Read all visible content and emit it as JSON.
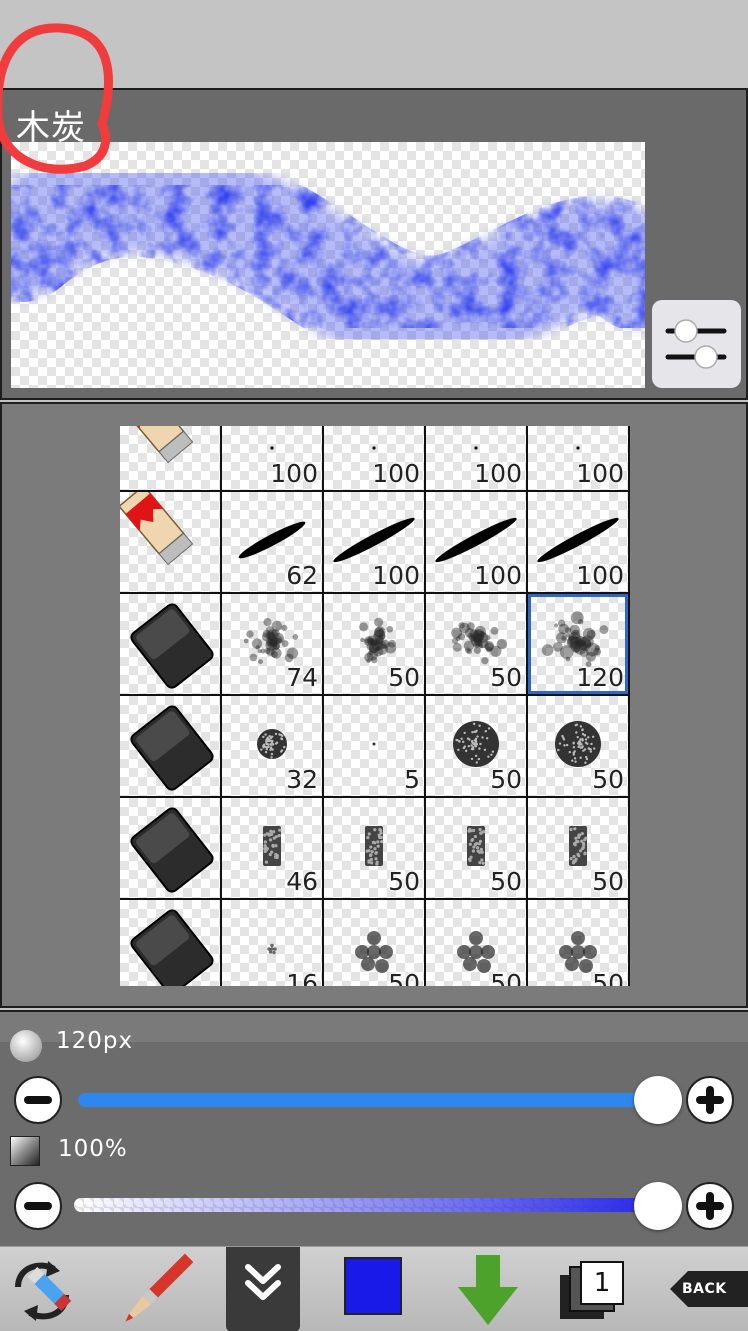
{
  "brush_preview": {
    "name": "木炭",
    "stroke_color": "#2d3ef0"
  },
  "brush_grid": {
    "rows": [
      {
        "category_icon": "pencil-icon",
        "values": [
          "100",
          "100",
          "100",
          "100"
        ],
        "shape": "dot"
      },
      {
        "category_icon": "pencil-icon",
        "values": [
          "62",
          "100",
          "100",
          "100"
        ],
        "shape": "ellipse"
      },
      {
        "category_icon": "eraser-icon",
        "values": [
          "74",
          "50",
          "50",
          "120"
        ],
        "shape": "charcoal"
      },
      {
        "category_icon": "eraser-icon",
        "values": [
          "32",
          "5",
          "50",
          "50"
        ],
        "shape": "disc"
      },
      {
        "category_icon": "eraser-icon",
        "values": [
          "46",
          "50",
          "50",
          "50"
        ],
        "shape": "rect"
      },
      {
        "category_icon": "eraser-icon",
        "values": [
          "16",
          "50",
          "50",
          "50"
        ],
        "shape": "cluster"
      }
    ],
    "selected": {
      "row": 2,
      "col": 3
    }
  },
  "brush_size": {
    "label": "120px",
    "fraction": 1.0,
    "track_color": "#2f86ee"
  },
  "brush_opacity": {
    "label": "100%",
    "fraction": 1.0,
    "track_color": "#2727e6"
  },
  "toolbar": {
    "current_color": "#1a1ae8",
    "layer_count": "1",
    "back_label": "BACK"
  }
}
